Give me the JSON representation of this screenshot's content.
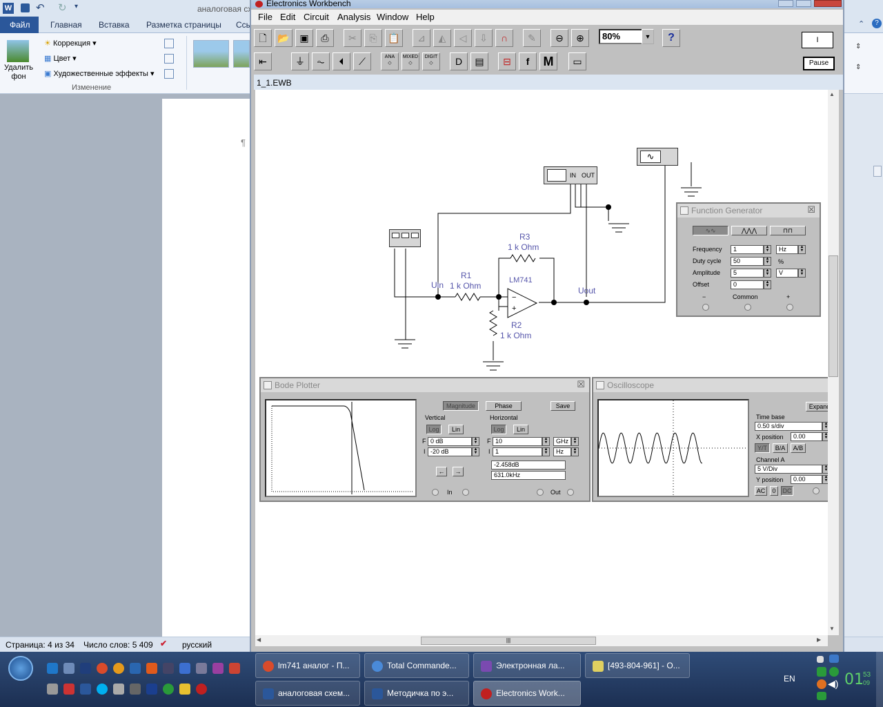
{
  "word": {
    "tabs": [
      "Файл",
      "Главная",
      "Вставка",
      "Разметка страницы",
      "Ссы"
    ],
    "title_fragment": "аналоговая сх",
    "ribbon": {
      "remove_bg": [
        "Удалить",
        "фон"
      ],
      "correction": "Коррекция",
      "color": "Цвет",
      "effects": "Художественные эффекты",
      "group_label": "Изменение"
    },
    "pilcrow": "¶",
    "status": {
      "page": "Страница: 4 из 34",
      "words": "Число слов: 5 409",
      "lang": "русский"
    }
  },
  "ewb": {
    "title": "Electronics Workbench",
    "menu": [
      "File",
      "Edit",
      "Circuit",
      "Analysis",
      "Window",
      "Help"
    ],
    "zoom": "80%",
    "pause_label": "Pause",
    "power_label": "I",
    "doc_title": "1_1.EWB",
    "toolbar_small_labels": [
      "ANA",
      "MIXED",
      "DIGIT"
    ],
    "m_label": "M",
    "f_label": "f",
    "circuit": {
      "r3": {
        "name": "R3",
        "value": "1 k Ohm"
      },
      "r1": {
        "name": "R1",
        "value": "1 k Ohm"
      },
      "r2": {
        "name": "R2",
        "value": "1 k Ohm"
      },
      "opamp": "LM741",
      "uin": "Uin",
      "uout": "Uout",
      "bode_in": "IN",
      "bode_out": "OUT"
    },
    "function_generator": {
      "title": "Function Generator",
      "frequency": {
        "label": "Frequency",
        "value": "1",
        "unit": "Hz"
      },
      "duty_cycle": {
        "label": "Duty cycle",
        "value": "50",
        "unit": "%"
      },
      "amplitude": {
        "label": "Amplitude",
        "value": "5",
        "unit": "V"
      },
      "offset": {
        "label": "Offset",
        "value": "0"
      },
      "terminals": [
        "−",
        "Common",
        "+"
      ]
    },
    "bode_plotter": {
      "title": "Bode Plotter",
      "mode_buttons": [
        "Magnitude",
        "Phase"
      ],
      "save": "Save",
      "vertical": {
        "label": "Vertical",
        "log": "Log",
        "lin": "Lin",
        "F": "0 dB",
        "I": "-20 dB"
      },
      "horizontal": {
        "label": "Horizontal",
        "log": "Log",
        "lin": "Lin",
        "F": "10",
        "F_unit": "GHz",
        "I": "1",
        "I_unit": "Hz"
      },
      "readout_db": "-2.458dB",
      "readout_freq": "631.0kHz",
      "in_label": "In",
      "out_label": "Out",
      "F_letter": "F",
      "I_letter": "I"
    },
    "oscilloscope": {
      "title": "Oscilloscope",
      "expand": "Expand",
      "time_base": {
        "label": "Time base",
        "value": "0.50 s/div"
      },
      "x_position": {
        "label": "X position",
        "value": "0.00"
      },
      "mode_buttons": [
        "Y/T",
        "B/A",
        "A/B"
      ],
      "channel_a": {
        "label": "Channel A",
        "value": "5  V/Div"
      },
      "y_position": {
        "label": "Y position",
        "value": "0.00"
      },
      "coupling": [
        "AC",
        "0",
        "DC"
      ]
    }
  },
  "taskbar": {
    "tasks_row1": [
      "lm741 аналог - П...",
      "Total Commande...",
      "Электронная ла...",
      "[493-804-961] - О..."
    ],
    "tasks_row2": [
      "аналоговая схем...",
      "Методичка по э...",
      "Electronics Work..."
    ],
    "lang": "EN",
    "clock_hm": "01",
    "clock_m": "53",
    "clock_s": "09"
  }
}
